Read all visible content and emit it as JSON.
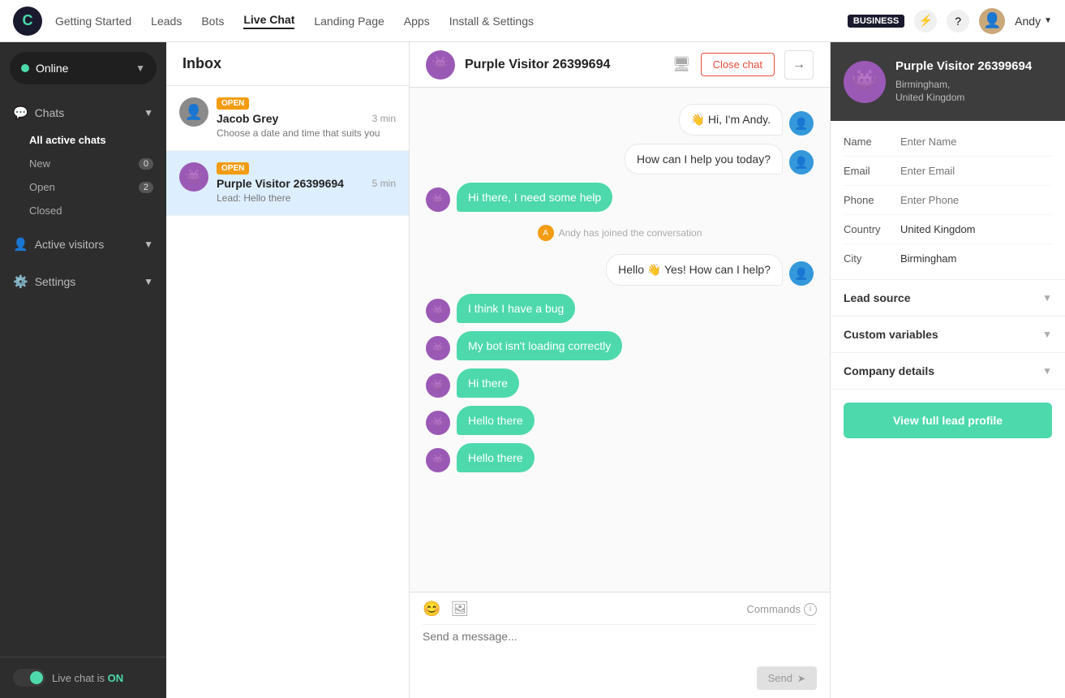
{
  "app": {
    "logo": "C",
    "nav_items": [
      {
        "label": "Getting Started",
        "active": false
      },
      {
        "label": "Leads",
        "active": false
      },
      {
        "label": "Bots",
        "active": false
      },
      {
        "label": "Live Chat",
        "active": true
      },
      {
        "label": "Landing Page",
        "active": false
      },
      {
        "label": "Apps",
        "active": false
      },
      {
        "label": "Install & Settings",
        "active": false
      }
    ],
    "business_badge": "BUSINESS",
    "user_name": "Andy",
    "user_avatar": "👤"
  },
  "sidebar": {
    "status": "Online",
    "sections": [
      {
        "label": "Chats",
        "icon": "💬",
        "sub_items": [
          {
            "label": "All active chats",
            "active": true,
            "count": null
          },
          {
            "label": "New",
            "active": false,
            "count": "0"
          },
          {
            "label": "Open",
            "active": false,
            "count": "2"
          },
          {
            "label": "Closed",
            "active": false,
            "count": null
          }
        ]
      },
      {
        "label": "Active visitors",
        "icon": "👤",
        "sub_items": []
      },
      {
        "label": "Settings",
        "icon": "⚙️",
        "sub_items": []
      }
    ],
    "live_chat_label": "Live chat is",
    "live_chat_status": "ON"
  },
  "inbox": {
    "title": "Inbox",
    "chats": [
      {
        "id": 1,
        "name": "Jacob Grey",
        "time": "3 min",
        "preview": "Choose a date and time that suits you",
        "status": "OPEN",
        "avatar": "👤",
        "active": false
      },
      {
        "id": 2,
        "name": "Purple Visitor 26399694",
        "time": "5 min",
        "preview": "Lead: Hello there",
        "status": "OPEN",
        "avatar": "👾",
        "active": true
      }
    ]
  },
  "chat": {
    "visitor_name": "Purple Visitor 26399694",
    "close_chat_label": "Close chat",
    "messages": [
      {
        "id": 1,
        "type": "agent",
        "text": "👋 Hi, I'm Andy.",
        "avatar": "👤"
      },
      {
        "id": 2,
        "type": "agent",
        "text": "How can I help you today?",
        "avatar": "👤"
      },
      {
        "id": 3,
        "type": "visitor",
        "text": "Hi there, I need some help",
        "avatar": "👾"
      },
      {
        "id": 4,
        "type": "system",
        "text": "Andy has joined the conversation"
      },
      {
        "id": 5,
        "type": "agent",
        "text": "Hello 👋 Yes! How can I help?",
        "avatar": "👤"
      },
      {
        "id": 6,
        "type": "visitor",
        "text": "I think I have a bug",
        "avatar": "👾"
      },
      {
        "id": 7,
        "type": "visitor",
        "text": "My bot isn't loading correctly",
        "avatar": "👾"
      },
      {
        "id": 8,
        "type": "visitor",
        "text": "Hi there",
        "avatar": "👾"
      },
      {
        "id": 9,
        "type": "visitor",
        "text": "Hello there",
        "avatar": "👾"
      },
      {
        "id": 10,
        "type": "visitor",
        "text": "Hello there",
        "avatar": "👾"
      }
    ],
    "input_placeholder": "Send a message...",
    "send_label": "Send",
    "commands_label": "Commands"
  },
  "right_panel": {
    "visitor": {
      "name": "Purple Visitor 26399694",
      "location": "Birmingham,\nUnited Kingdom",
      "avatar": "👾"
    },
    "fields": [
      {
        "label": "Name",
        "placeholder": "Enter Name",
        "value": ""
      },
      {
        "label": "Email",
        "placeholder": "Enter Email",
        "value": ""
      },
      {
        "label": "Phone",
        "placeholder": "Enter Phone",
        "value": ""
      },
      {
        "label": "Country",
        "placeholder": "",
        "value": "United Kingdom"
      },
      {
        "label": "City",
        "placeholder": "",
        "value": "Birmingham"
      }
    ],
    "sections": [
      {
        "label": "Lead source"
      },
      {
        "label": "Custom variables"
      },
      {
        "label": "Company details"
      }
    ],
    "view_profile_label": "View full lead profile"
  }
}
